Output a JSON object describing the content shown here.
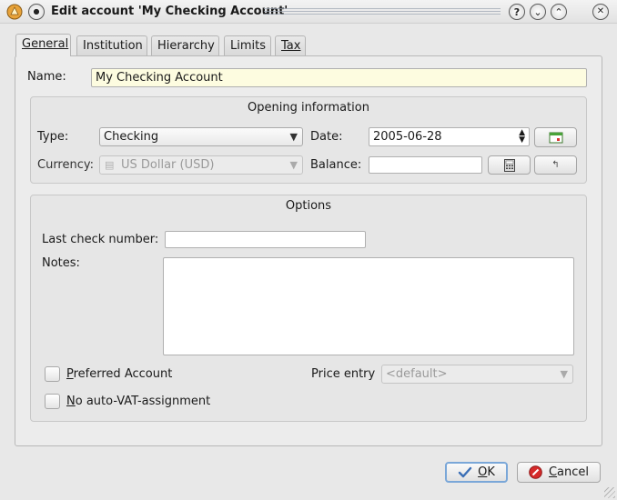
{
  "window": {
    "title": "Edit account 'My Checking Account'",
    "buttons": {
      "help": "?",
      "minimize": "⌄",
      "maximize": "⌃",
      "close": "✕"
    }
  },
  "tabs": [
    {
      "label": "General",
      "active": true
    },
    {
      "label": "Institution"
    },
    {
      "label": "Hierarchy"
    },
    {
      "label": "Limits"
    },
    {
      "label": "Tax"
    }
  ],
  "general": {
    "name_label": "Name:",
    "name_value": "My Checking Account",
    "opening": {
      "title": "Opening information",
      "type_label": "Type:",
      "type_value": "Checking",
      "date_label": "Date:",
      "date_value": "2005-06-28",
      "currency_label": "Currency:",
      "currency_value": "US Dollar (USD)",
      "balance_label": "Balance:",
      "balance_value": ""
    },
    "options": {
      "title": "Options",
      "last_check_label": "Last check number:",
      "last_check_value": "",
      "notes_label": "Notes:",
      "notes_value": "",
      "preferred_first": "P",
      "preferred_rest": "referred Account",
      "price_entry_label": "Price entry",
      "price_entry_value": "<default>",
      "novat_first": "N",
      "novat_rest": "o auto-VAT-assignment"
    }
  },
  "footer": {
    "ok_first": "O",
    "ok_rest": "K",
    "cancel_first": "C",
    "cancel_rest": "ancel"
  },
  "colors": {
    "name_field_bg": "#fdfce0",
    "focus_border": "#7aa7d8",
    "cancel_icon": "#d62a2a",
    "ok_icon": "#3b6fb6"
  }
}
